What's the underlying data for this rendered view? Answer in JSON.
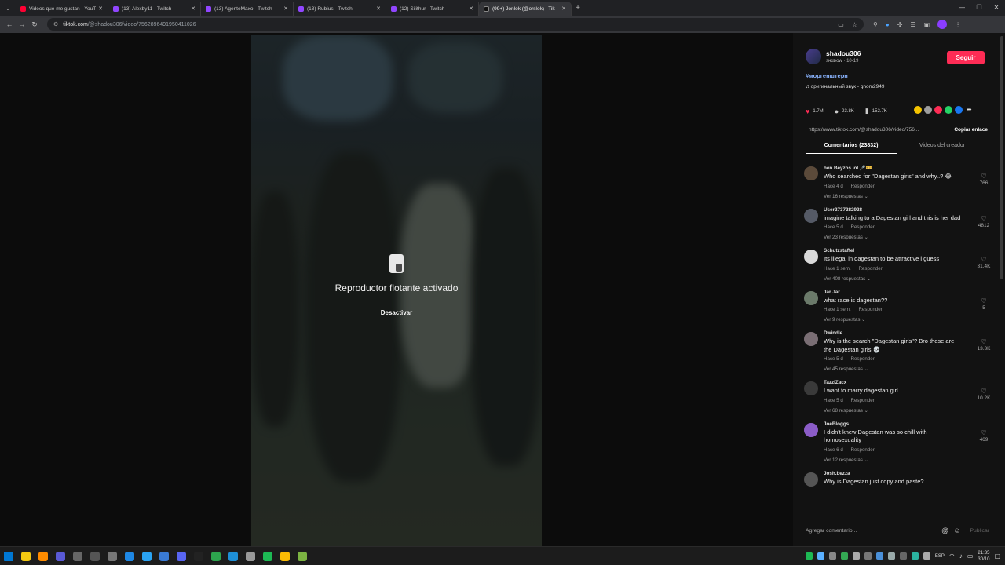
{
  "browser": {
    "tabs": [
      {
        "title": "Videos que me gustan - YouTube",
        "fav": "yt"
      },
      {
        "title": "(13) Alexby11 - Twitch",
        "fav": "tw"
      },
      {
        "title": "(13) AgenteMaxo - Twitch",
        "fav": "tw"
      },
      {
        "title": "(13) Rubius - Twitch",
        "fav": "tw"
      },
      {
        "title": "(12) Silithur - Twitch",
        "fav": "tw"
      },
      {
        "title": "(99+) Jonlok (@orslok) | Tik",
        "fav": "tt"
      }
    ],
    "url_host": "tiktok.com",
    "url_path": "/@shadou306/video/7562896491950411026"
  },
  "video": {
    "pip_title": "Reproductor flotante activado",
    "pip_button": "Desactivar"
  },
  "author": {
    "username": "shadou306",
    "subline": "sнαᴅᴏᴡ · 10-19",
    "follow": "Seguir",
    "hashtag": "#моргенштерн",
    "sound": "♫  оригинальный звук - gnom2949"
  },
  "stats": {
    "likes": "1.7M",
    "comments": "23.8K",
    "saves": "152.7K"
  },
  "link": {
    "url": "https://www.tiktok.com/@shadou306/video/756...",
    "copy": "Copiar enlace"
  },
  "panel_tabs": {
    "comments": "Comentarios (23832)",
    "creator_videos": "Videos del creador"
  },
  "comments": [
    {
      "user": "ben Beyzoş lol 🎤🎫",
      "text": "Who searched for \"Dagestan girls\" and why..? 😂",
      "time": "Hace 4 d",
      "reply": "Responder",
      "more": "Ver 16 respuestas ⌄",
      "likes": "766",
      "avatar": "#5b4a3a"
    },
    {
      "user": "User2737282928",
      "text": "imagine talking to a Dagestan girl and this is her dad",
      "time": "Hace 5 d",
      "reply": "Responder",
      "more": "Ver 23 respuestas ⌄",
      "likes": "4812",
      "avatar": "#555a66"
    },
    {
      "user": "Schutzstaffel",
      "text": "Its illegal in dagestan to be attractive i guess",
      "time": "Hace 1 sem.",
      "reply": "Responder",
      "more": "Ver 408 respuestas ⌄",
      "likes": "31.4K",
      "avatar": "#d9d9d9"
    },
    {
      "user": "Jar Jar",
      "text": "what race is dagestan??",
      "time": "Hace 1 sem.",
      "reply": "Responder",
      "more": "Ver 9 respuestas ⌄",
      "likes": "5",
      "avatar": "#6b7a6a"
    },
    {
      "user": "Dwindle",
      "text": "Why is the search \"Dagestan girls\"? Bro these are the Dagestan girls 💀",
      "time": "Hace 5 d",
      "reply": "Responder",
      "more": "Ver 45 respuestas ⌄",
      "likes": "13.3K",
      "avatar": "#7a6e74"
    },
    {
      "user": "TazziZacx",
      "text": "I want to marry dagestan girl",
      "time": "Hace 5 d",
      "reply": "Responder",
      "more": "Ver 68 respuestas ⌄",
      "likes": "10.2K",
      "avatar": "#3a3a3a"
    },
    {
      "user": "JoeBloggs",
      "text": "I didn't knew Dagestan was so chill with homosexuality",
      "time": "Hace 6 d",
      "reply": "Responder",
      "more": "Ver 12 respuestas ⌄",
      "likes": "469",
      "avatar": "#8b5cc7"
    },
    {
      "user": "Josh.bezza",
      "text": "Why is Dagestan just copy and paste?",
      "time": "",
      "reply": "",
      "more": "",
      "likes": "",
      "avatar": "#555"
    }
  ],
  "composer": {
    "placeholder": "Agregar comentario...",
    "post": "Publicar"
  },
  "taskbar": {
    "lang": "ESP",
    "time": "21:35",
    "date": "30/10"
  },
  "colors": {
    "accent": "#fe2c55",
    "link": "#8ab4ff"
  }
}
